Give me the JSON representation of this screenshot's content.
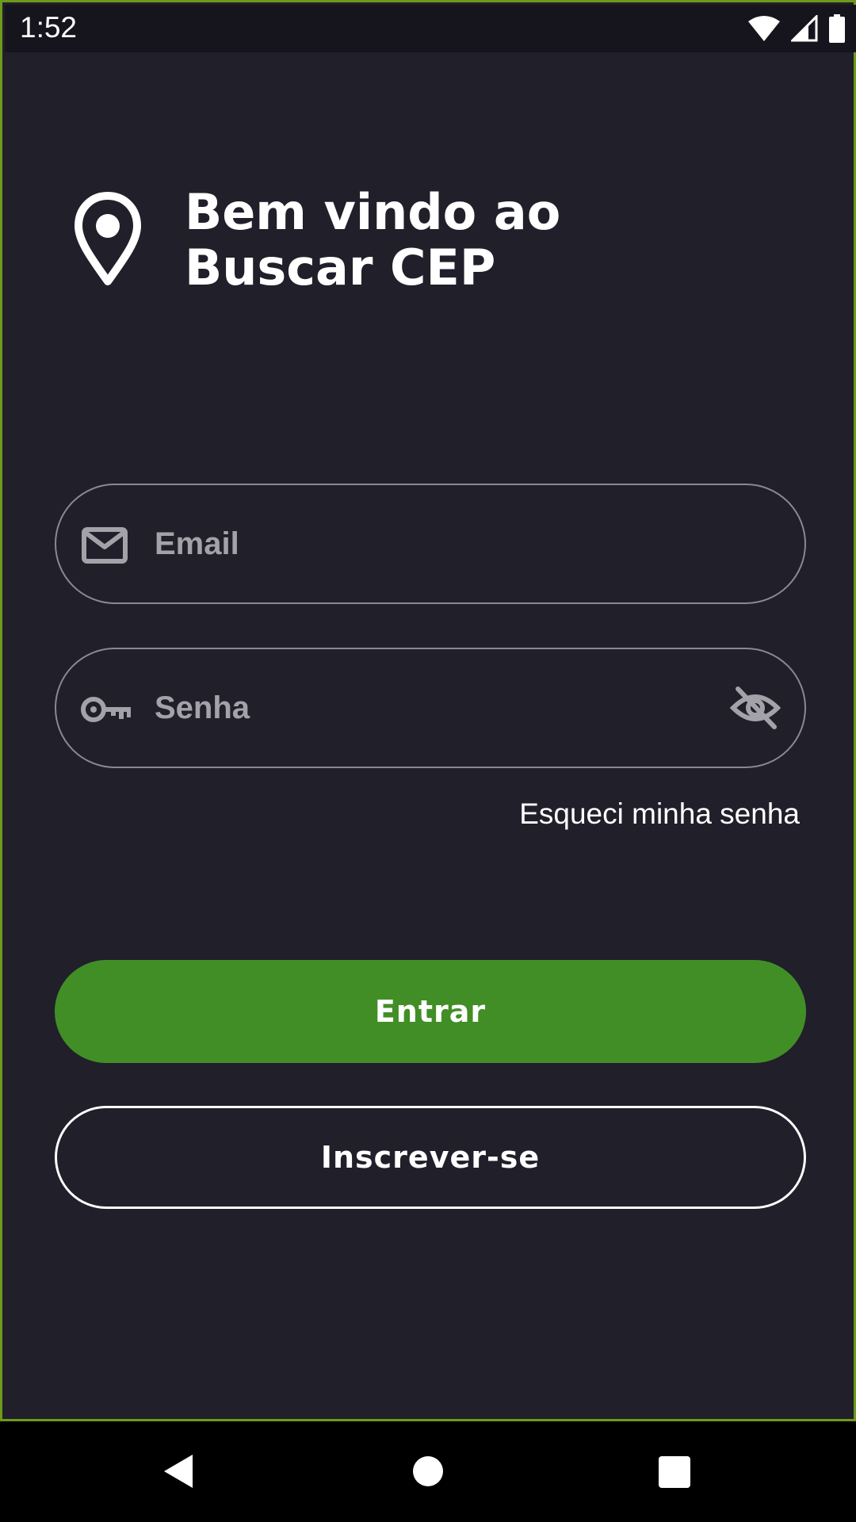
{
  "status_bar": {
    "time": "1:52",
    "icons": [
      "wifi-icon",
      "signal-icon",
      "battery-icon"
    ]
  },
  "header": {
    "icon": "location-pin-icon",
    "title": "Bem vindo ao\nBuscar CEP"
  },
  "form": {
    "email": {
      "icon": "mail-icon",
      "placeholder": "Email",
      "value": ""
    },
    "password": {
      "icon": "key-icon",
      "placeholder": "Senha",
      "value": "",
      "toggle_icon": "eye-off-icon"
    },
    "forgot_password": "Esqueci minha senha"
  },
  "buttons": {
    "login": "Entrar",
    "signup": "Inscrever-se"
  },
  "nav": {
    "icons": [
      "back-icon",
      "home-icon",
      "recents-icon"
    ]
  },
  "colors": {
    "background": "#201f2a",
    "status_bar": "#16151d",
    "accent_green": "#428e26",
    "frame_border": "#6e9a1a",
    "field_border": "#8a8992",
    "placeholder": "#a3a2a9"
  }
}
